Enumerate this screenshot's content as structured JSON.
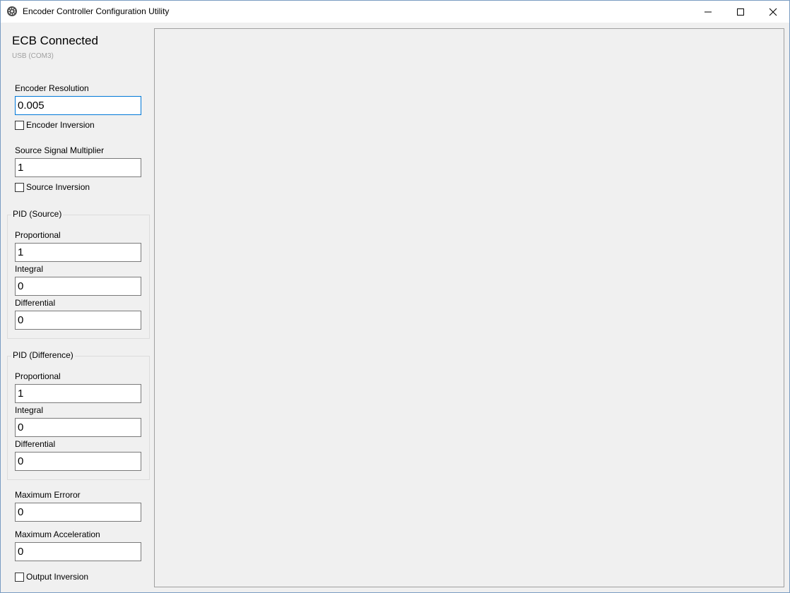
{
  "window": {
    "title": "Encoder Controller Configuration Utility"
  },
  "status": {
    "title": "ECB Connected",
    "subtitle": "USB (COM3)"
  },
  "encoder": {
    "resolution_label": "Encoder Resolution",
    "resolution_value": "0.005",
    "inversion_label": "Encoder Inversion",
    "inversion_checked": false
  },
  "source": {
    "multiplier_label": "Source Signal Multiplier",
    "multiplier_value": "1",
    "inversion_label": "Source Inversion",
    "inversion_checked": false
  },
  "pid_source": {
    "title": "PID (Source)",
    "proportional_label": "Proportional",
    "proportional_value": "1",
    "integral_label": "Integral",
    "integral_value": "0",
    "differential_label": "Differential",
    "differential_value": "0"
  },
  "pid_difference": {
    "title": "PID (Difference)",
    "proportional_label": "Proportional",
    "proportional_value": "1",
    "integral_label": "Integral",
    "integral_value": "0",
    "differential_label": "Differential",
    "differential_value": "0"
  },
  "limits": {
    "max_error_label": "Maximum Erroror",
    "max_error_value": "0",
    "max_accel_label": "Maximum Acceleration",
    "max_accel_value": "0"
  },
  "output": {
    "inversion_label": "Output Inversion",
    "inversion_checked": false
  },
  "icons": {
    "app": "gear-icon",
    "minimize": "minimize-icon",
    "maximize": "maximize-icon",
    "close": "close-icon"
  },
  "colors": {
    "focus_border": "#0078d7",
    "window_bg": "#f0f0f0"
  }
}
